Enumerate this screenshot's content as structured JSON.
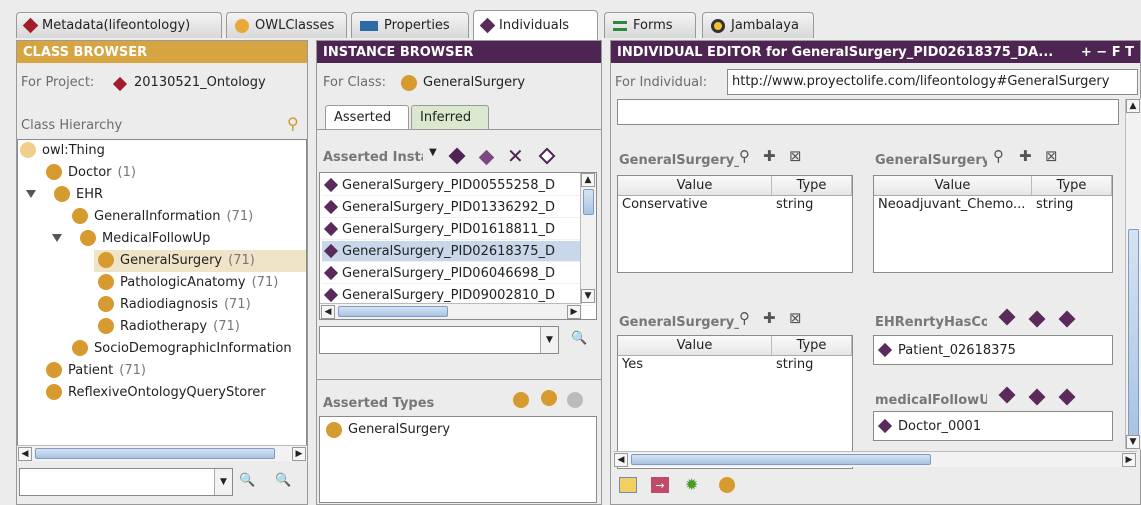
{
  "tabs": [
    {
      "label": "Metadata(lifeontology)",
      "icon": "diamond-red-icon"
    },
    {
      "label": "OWLClasses",
      "icon": "class-dot-icon"
    },
    {
      "label": "Properties",
      "icon": "property-rect-icon"
    },
    {
      "label": "Individuals",
      "icon": "individual-diamond-icon",
      "active": true
    },
    {
      "label": "Forms",
      "icon": "forms-icon"
    },
    {
      "label": "Jambalaya",
      "icon": "jambalaya-icon"
    }
  ],
  "class_browser": {
    "title": "CLASS BROWSER",
    "project_label": "For Project:",
    "project_name": "20130521_Ontology",
    "hierarchy_label": "Class Hierarchy",
    "tree": [
      {
        "label": "owl:Thing",
        "count": ""
      },
      {
        "label": "Doctor",
        "count": "(1)"
      },
      {
        "label": "EHR",
        "count": ""
      },
      {
        "label": "GeneralInformation",
        "count": "(71)"
      },
      {
        "label": "MedicalFollowUp",
        "count": ""
      },
      {
        "label": "GeneralSurgery",
        "count": "(71)"
      },
      {
        "label": "PathologicAnatomy",
        "count": "(71)"
      },
      {
        "label": "Radiodiagnosis",
        "count": "(71)"
      },
      {
        "label": "Radiotherapy",
        "count": "(71)"
      },
      {
        "label": "SocioDemographicInformation",
        "count": ""
      },
      {
        "label": "Patient",
        "count": "(71)"
      },
      {
        "label": "ReflexiveOntologyQueryStorer",
        "count": ""
      }
    ]
  },
  "instance_browser": {
    "title": "INSTANCE BROWSER",
    "for_class_label": "For Class:",
    "class_name": "GeneralSurgery",
    "subtabs": [
      "Asserted",
      "Inferred"
    ],
    "asserted_instances_label": "Asserted Instar",
    "instances": [
      "GeneralSurgery_PID00555258_D",
      "GeneralSurgery_PID01336292_D",
      "GeneralSurgery_PID01618811_D",
      "GeneralSurgery_PID02618375_D",
      "GeneralSurgery_PID06046698_D",
      "GeneralSurgery_PID09002810_D"
    ],
    "asserted_types_label": "Asserted Types",
    "types": [
      "GeneralSurgery"
    ]
  },
  "individual_editor": {
    "title": "INDIVIDUAL EDITOR for GeneralSurgery_PID02618375_DA...",
    "title_controls": "+ − F T",
    "for_individual_label": "For Individual:",
    "individual_uri": "http://www.proyectolife.com/lifeontology#GeneralSurgery",
    "slots": [
      {
        "title": "GeneralSurgery_Inte",
        "col_value": "Value",
        "col_type": "Type",
        "value": "Conservative",
        "type": "string"
      },
      {
        "title": "GeneralSurgery_Pre",
        "col_value": "Value",
        "col_type": "Type",
        "value": "Neoadjuvant_Chemo...",
        "type": "string"
      },
      {
        "title": "GeneralSurgery_Pre",
        "col_value": "Value",
        "col_type": "Type",
        "value": "Yes",
        "type": "string"
      }
    ],
    "object_slots": [
      {
        "title": "EHRenrtyHasCorres",
        "value": "Patient_02618375"
      },
      {
        "title": "medicalFollowUpHa",
        "value": "Doctor_0001"
      }
    ]
  }
}
